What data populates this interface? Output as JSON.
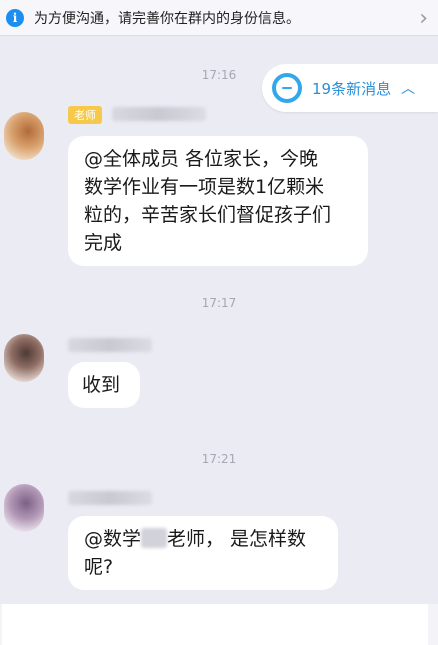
{
  "notice": {
    "icon": "info-icon",
    "text": "为方便沟通，请完善你在群内的身份信息。",
    "chevron": "›"
  },
  "new_messages": {
    "label": "19条新消息",
    "caret": "︿"
  },
  "messages": [
    {
      "time": "17:16",
      "role_tag": "老师",
      "text_lines": [
        "@全体成员 各位家长，今晚",
        "数学作业有一项是数1亿颗米",
        "粒的，辛苦家长们督促孩子们",
        "完成"
      ]
    },
    {
      "time": "17:17",
      "text": "收到"
    },
    {
      "time": "17:21",
      "text_before": "@数学",
      "text_after": "老师，  是怎样数",
      "text_line2": "呢?"
    }
  ],
  "colors": {
    "background": "#ebebf3",
    "accent_blue": "#2a8fd6",
    "teacher_tag": "#f6c94a"
  }
}
